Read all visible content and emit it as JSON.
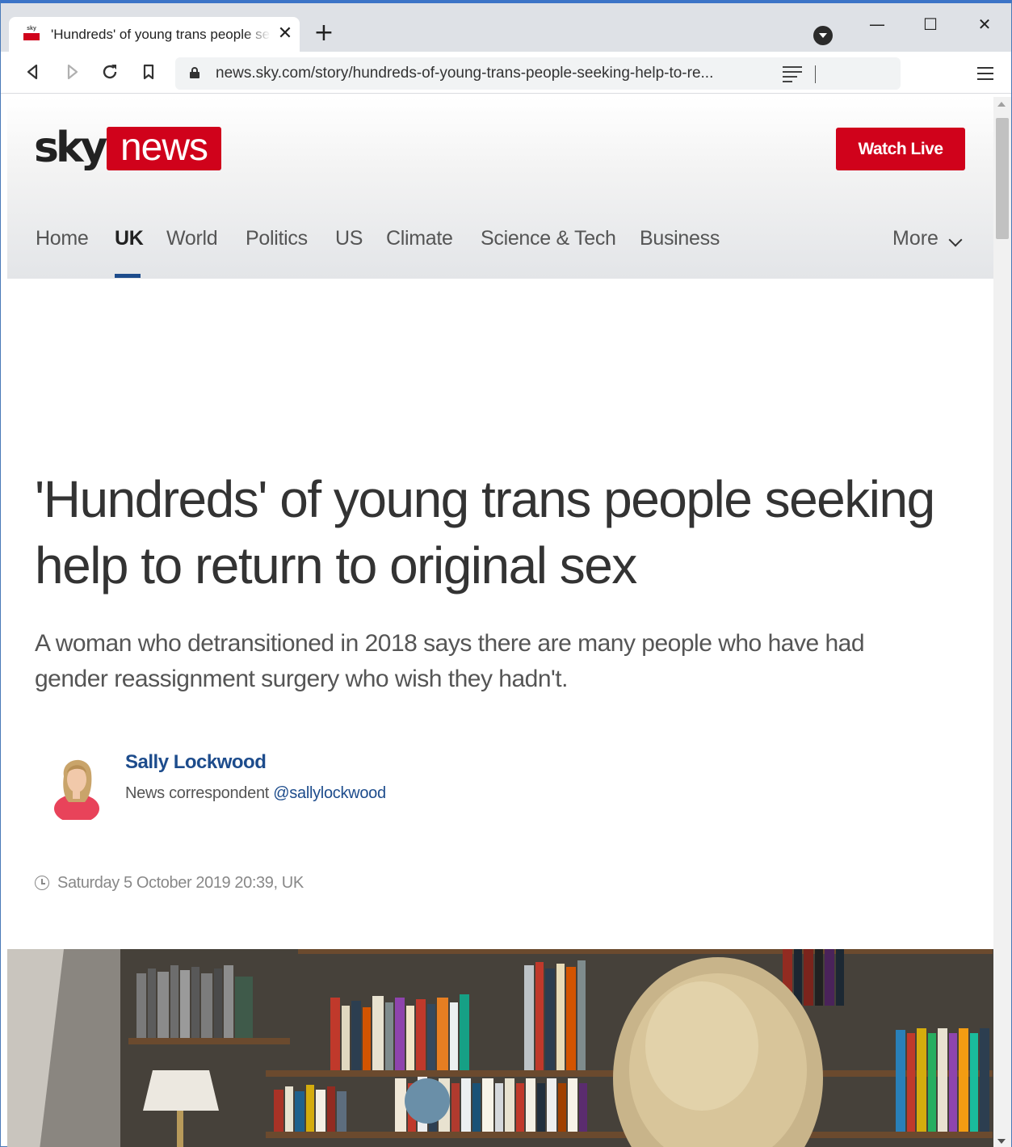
{
  "browser": {
    "tab_title": "'Hundreds' of young trans people seeking help to return to original sex",
    "tab_favicon_text": "sky",
    "tab_close": "✕",
    "new_tab": "+",
    "window_controls": {
      "minimize": "—",
      "maximize": "☐",
      "close": "✕"
    },
    "url": "news.sky.com/story/hundreds-of-young-trans-people-seeking-help-to-re...",
    "icons": [
      "back-icon",
      "forward-icon",
      "reload-icon",
      "bookmark-icon",
      "lock-icon",
      "reader-view-icon",
      "menu-icon",
      "profile-icon"
    ]
  },
  "masthead": {
    "logo_sky": "sky",
    "logo_news": "news",
    "watch_live": "Watch Live",
    "nav": [
      {
        "label": "Home",
        "active": false
      },
      {
        "label": "UK",
        "active": true
      },
      {
        "label": "World",
        "active": false
      },
      {
        "label": "Politics",
        "active": false
      },
      {
        "label": "US",
        "active": false
      },
      {
        "label": "Climate",
        "active": false
      },
      {
        "label": "Science & Tech",
        "active": false
      },
      {
        "label": "Business",
        "active": false
      }
    ],
    "more": "More"
  },
  "article": {
    "headline": "'Hundreds' of young trans people seeking help to return to original sex",
    "standfirst": "A woman who detransitioned in 2018 says there are many people who have had gender reassignment surgery who wish they hadn't.",
    "author": {
      "name": "Sally Lockwood",
      "role": "News correspondent",
      "handle": "@sallylockwood"
    },
    "timestamp": "Saturday 5 October 2019 20:39, UK"
  },
  "colors": {
    "brand_red": "#d0021b",
    "link_blue": "#1d4c8c",
    "nav_active_underline": "#1d4c8c"
  }
}
